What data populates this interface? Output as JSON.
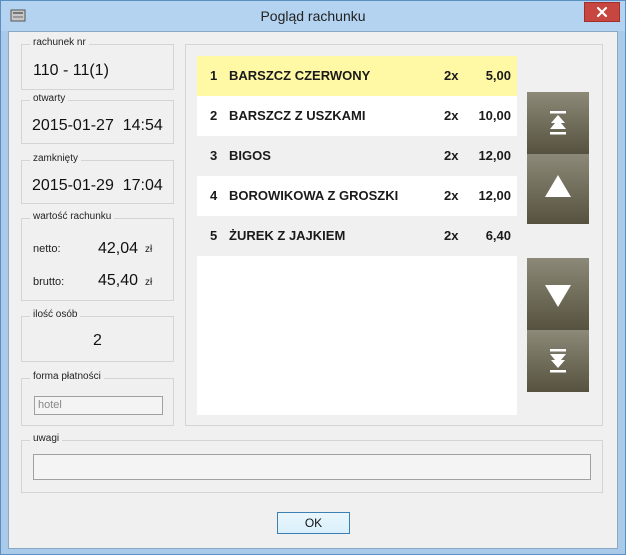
{
  "window": {
    "title": "Pogląd rachunku"
  },
  "receipt_no": {
    "label": "rachunek nr",
    "value": "110 - 11(1)"
  },
  "opened": {
    "label": "otwarty",
    "value": "2015-01-27  14:54"
  },
  "closed": {
    "label": "zamknięty",
    "value": "2015-01-29  17:04"
  },
  "bill_value": {
    "label": "wartość rachunku",
    "netto_label": "netto:",
    "netto_value": "42,04",
    "brutto_label": "brutto:",
    "brutto_value": "45,40",
    "unit": "zł"
  },
  "guests": {
    "label": "ilość osób",
    "value": "2"
  },
  "payment": {
    "label": "forma płatności",
    "value": "hotel"
  },
  "items": [
    {
      "num": "1",
      "name": "BARSZCZ CZERWONY",
      "qty": "2x",
      "price": "5,00"
    },
    {
      "num": "2",
      "name": "BARSZCZ Z USZKAMI",
      "qty": "2x",
      "price": "10,00"
    },
    {
      "num": "3",
      "name": "BIGOS",
      "qty": "2x",
      "price": "12,00"
    },
    {
      "num": "4",
      "name": "BOROWIKOWA Z GROSZKI",
      "qty": "2x",
      "price": "12,00"
    },
    {
      "num": "5",
      "name": "ŻUREK Z JAJKIEM",
      "qty": "2x",
      "price": "6,40"
    }
  ],
  "remarks": {
    "label": "uwagi",
    "value": ""
  },
  "ok_button": {
    "label": "OK"
  },
  "colors": {
    "selected_row": "#fff9a6",
    "alt_row": "#f0f0f0",
    "nav_button_top": "#8d8978",
    "nav_button_bottom": "#56523f"
  },
  "icons": {
    "scroll_top": "double-up-arrow-icon",
    "scroll_up": "up-triangle-icon",
    "scroll_down": "down-triangle-icon",
    "scroll_bottom": "double-down-arrow-icon",
    "close": "close-icon"
  }
}
